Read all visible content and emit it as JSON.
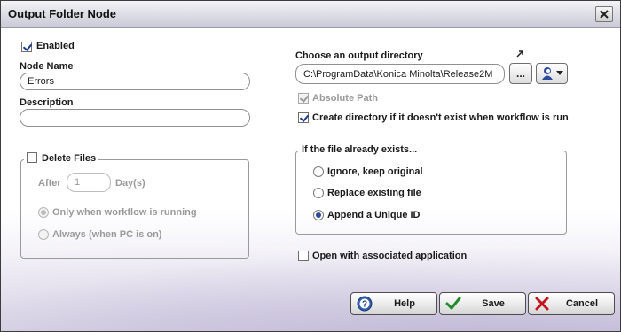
{
  "window": {
    "title": "Output Folder Node"
  },
  "left": {
    "enabled_label": "Enabled",
    "enabled_checked": true,
    "node_name_label": "Node Name",
    "node_name_value": "Errors",
    "description_label": "Description",
    "description_value": "",
    "delete_files": {
      "label": "Delete Files",
      "checked": false,
      "after_label": "After",
      "days_value": "1",
      "days_label": "Day(s)",
      "options": [
        {
          "label": "Only when workflow is running",
          "selected": true
        },
        {
          "label": "Always (when PC is on)",
          "selected": false
        }
      ]
    }
  },
  "right": {
    "output_dir_label": "Choose an output directory",
    "output_dir_value": "C:\\ProgramData\\Konica Minolta\\Release2M",
    "browse_label": "...",
    "absolute_path_label": "Absolute Path",
    "absolute_path_checked": true,
    "create_dir_label": "Create directory if it doesn't exist when workflow is run",
    "create_dir_checked": true,
    "file_exists": {
      "label": "If the file already exists...",
      "options": [
        {
          "label": "Ignore, keep original",
          "selected": false
        },
        {
          "label": "Replace existing file",
          "selected": false
        },
        {
          "label": "Append a Unique ID",
          "selected": true
        }
      ]
    },
    "open_app_label": "Open with associated application",
    "open_app_checked": false
  },
  "buttons": {
    "help": "Help",
    "save": "Save",
    "cancel": "Cancel"
  },
  "icons": {
    "close": "close-icon",
    "help": "help-icon",
    "save": "checkmark-icon",
    "cancel": "x-icon",
    "variables": "person-icon",
    "dropdown": "chevron-down-icon",
    "resize": "diagonal-arrow-icon"
  },
  "colors": {
    "accent": "#2a4a9a",
    "save_check": "#1f8a2a",
    "cancel_x": "#c4141c"
  }
}
